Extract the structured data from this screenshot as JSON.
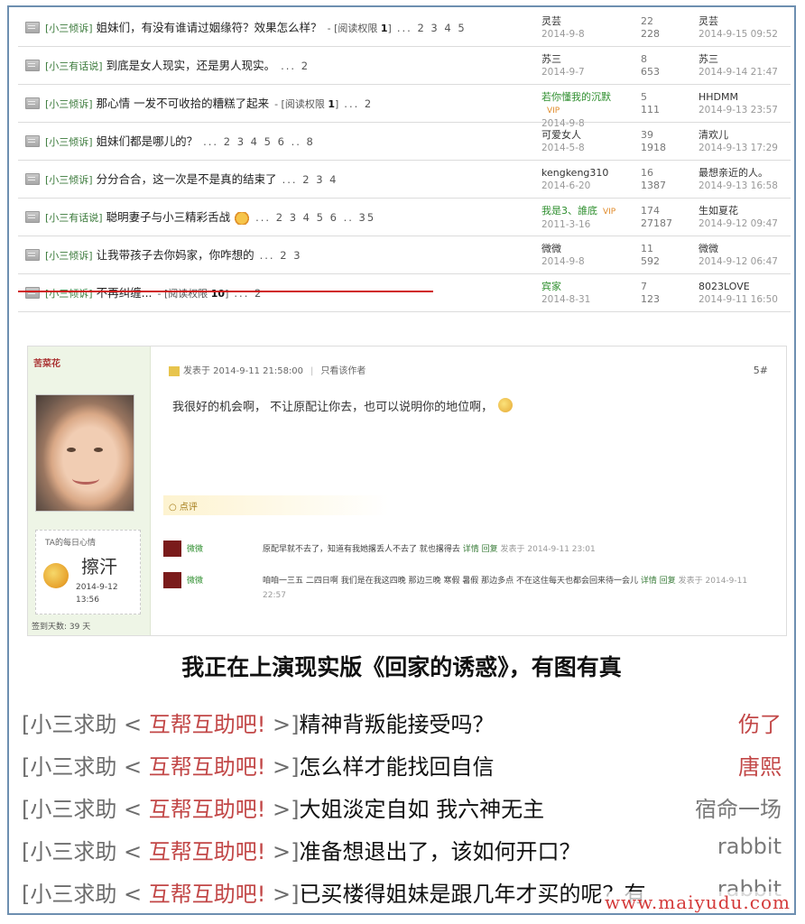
{
  "threads": [
    {
      "cat": "[小三倾诉]",
      "subject": "姐妹们，有没有谁请过姻缘符？效果怎么样？",
      "perm": "- [阅读权限 ",
      "perm_level": "1",
      "perm_close": "]",
      "pages": "... 2 3 4 5",
      "author": "灵芸",
      "author_date": "2014-9-8",
      "replies": "22",
      "views": "228",
      "last_user": "灵芸",
      "last_date": "2014-9-15 09:52"
    },
    {
      "cat": "[小三有话说]",
      "subject": "到底是女人现实，还是男人现实。",
      "pages": "... 2",
      "author": "苏三",
      "author_date": "2014-9-7",
      "replies": "8",
      "views": "653",
      "last_user": "苏三",
      "last_date": "2014-9-14 21:47"
    },
    {
      "cat": "[小三倾诉]",
      "subject": "那心情 一发不可收拾的糟糕了起来",
      "perm": "- [阅读权限 ",
      "perm_level": "1",
      "perm_close": "]",
      "pages": "... 2",
      "author": "若你懂我的沉默",
      "author_vip": "VIP",
      "author_date": "2014-9-8",
      "replies": "5",
      "views": "111",
      "last_user": "HHDMM",
      "last_date": "2014-9-13 23:57"
    },
    {
      "cat": "[小三倾诉]",
      "subject": "姐妹们都是哪儿的？",
      "pages": "... 2 3 4 5 6 .. 8",
      "author": "可爱女人",
      "author_date": "2014-5-8",
      "replies": "39",
      "views": "1918",
      "last_user": "清欢儿",
      "last_date": "2014-9-13 17:29"
    },
    {
      "cat": "[小三倾诉]",
      "subject": "分分合合，这一次是不是真的结束了",
      "pages": "... 2 3 4",
      "author": "kengkeng310",
      "author_date": "2014-6-20",
      "replies": "16",
      "views": "1387",
      "last_user": "最想亲近的人。",
      "last_date": "2014-9-13 16:58"
    },
    {
      "cat": "[小三有话说]",
      "subject": "聪明妻子与小三精彩舌战",
      "pages": "... 2 3 4 5 6 .. 35",
      "author": "我是3、誰底",
      "author_vip": "VIP",
      "author_date": "2011-3-16",
      "replies": "174",
      "views": "27187",
      "last_user": "生如夏花",
      "last_date": "2014-9-12 09:47"
    },
    {
      "cat": "[小三倾诉]",
      "subject": "让我带孩子去你妈家，你咋想的",
      "pages": "... 2 3",
      "author": "微微",
      "author_date": "2014-9-8",
      "replies": "11",
      "views": "592",
      "last_user": "微微",
      "last_date": "2014-9-12 06:47"
    },
    {
      "cat": "[小三倾诉]",
      "subject": "不再纠缠...",
      "perm": "- [阅读权限 ",
      "perm_level": "10",
      "perm_close": "]",
      "pages": "... 2",
      "author": "宾家",
      "author_date": "2014-8-31",
      "replies": "7",
      "views": "123",
      "last_user": "8023LOVE",
      "last_date": "2014-9-11 16:50"
    }
  ],
  "post": {
    "username": "苦菜花",
    "meta": "发表于 2014-9-11 21:58:00",
    "only_author": "只看该作者",
    "floor": "5#",
    "content": "我很好的机会啊， 不让原配让你去，也可以说明你的地位啊，",
    "rate_label": "○ 点评",
    "mood_label": "TA的每日心情",
    "mood_text": "擦汗",
    "mood_date": "2014-9-12 13:56",
    "signin": "签到天数: 39 天",
    "replies": [
      {
        "name": "微微",
        "text": "原配早就不去了，知道有我她撂丢人不去了 就也撂得去",
        "links": "详情 回复",
        "time": "发表于 2014-9-11 23:01"
      },
      {
        "name": "微微",
        "text": "咱咱一三五 二四日啊 我们是在我这四晚 那边三晚 寒假 暑假 那边多点 不在这住每天也都会回来待一会儿",
        "links": "详情 回复",
        "time": "发表于 2014-9-11 22:57"
      }
    ]
  },
  "headline": "我正在上演现实版《回家的诱惑》，有图有真",
  "help_items": [
    {
      "cat": "[小三求助 < ",
      "board": "互帮互助吧!",
      "close": " >]",
      "topic": "精神背叛能接受吗？",
      "poster": "伤了",
      "poster_gray": false
    },
    {
      "cat": "[小三求助 < ",
      "board": "互帮互助吧!",
      "close": " >]",
      "topic": "怎么样才能找回自信",
      "poster": "唐熙",
      "poster_gray": false
    },
    {
      "cat": "[小三求助 < ",
      "board": "互帮互助吧!",
      "close": " >]",
      "topic": "大姐淡定自如 我六神无主",
      "poster": "宿命一场",
      "poster_gray": true
    },
    {
      "cat": "[小三求助 < ",
      "board": "互帮互助吧!",
      "close": " >]",
      "topic": "准备想退出了，该如何开口？",
      "poster": "rabbit",
      "poster_gray": true
    },
    {
      "cat": "[小三求助 < ",
      "board": "互帮互助吧!",
      "close": " >]",
      "topic": "已买楼得姐妹是跟几年才买的呢？有",
      "poster": "rabbit",
      "poster_gray": true
    }
  ],
  "watermark": "www.maiyudu.com"
}
